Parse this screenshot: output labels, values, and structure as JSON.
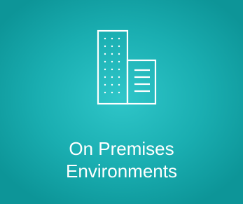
{
  "tile": {
    "title_line1": "On Premises",
    "title_line2": "Environments",
    "icon": "office-building-icon",
    "background_color": "#1aaeb1",
    "text_color": "#ffffff"
  }
}
